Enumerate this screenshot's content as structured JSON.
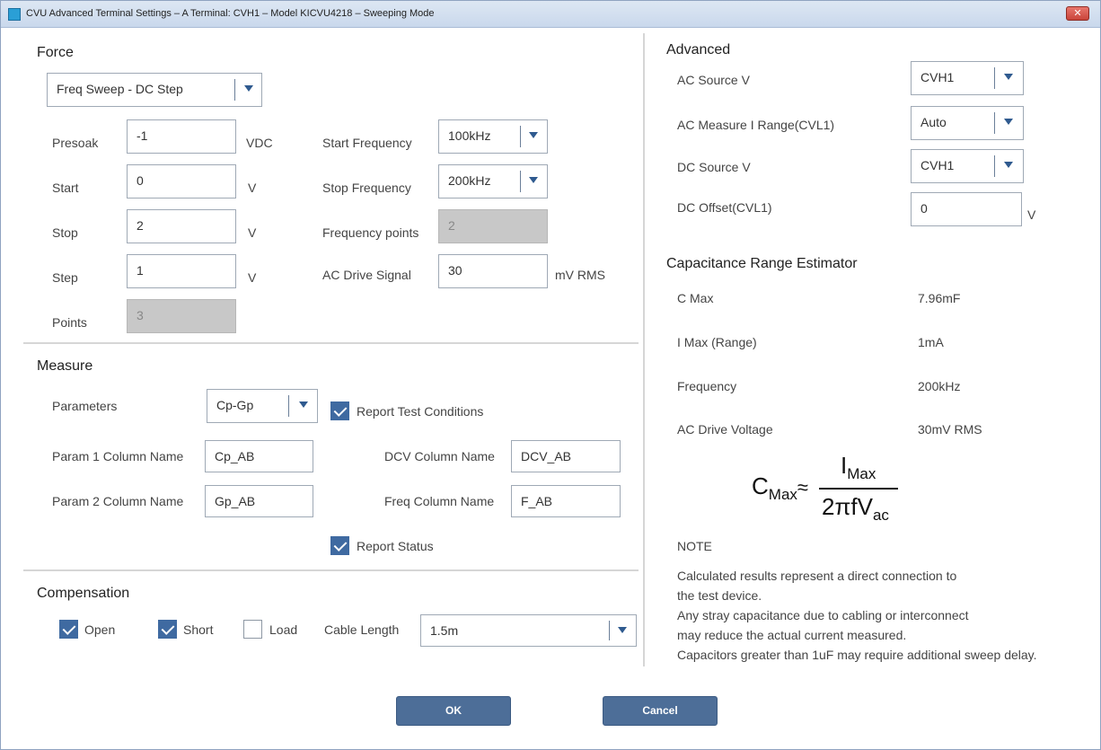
{
  "window": {
    "title": "CVU Advanced Terminal Settings – A Terminal: CVH1 – Model KICVU4218 – Sweeping Mode",
    "close": "✕"
  },
  "force": {
    "title": "Force",
    "mode": "Freq Sweep - DC Step",
    "presoak": {
      "label": "Presoak",
      "value": "-1",
      "unit": "VDC"
    },
    "start": {
      "label": "Start",
      "value": "0",
      "unit": "V"
    },
    "stop": {
      "label": "Stop",
      "value": "2",
      "unit": "V"
    },
    "step": {
      "label": "Step",
      "value": "1",
      "unit": "V"
    },
    "points": {
      "label": "Points",
      "value": "3"
    },
    "start_frequency": {
      "label": "Start Frequency",
      "value": "100kHz"
    },
    "stop_frequency": {
      "label": "Stop Frequency",
      "value": "200kHz"
    },
    "frequency_points": {
      "label": "Frequency points",
      "value": "2"
    },
    "ac_drive_signal": {
      "label": "AC Drive Signal",
      "value": "30",
      "unit": "mV RMS"
    }
  },
  "measure": {
    "title": "Measure",
    "parameters": {
      "label": "Parameters",
      "value": "Cp-Gp"
    },
    "report_test_conditions": {
      "label": "Report Test Conditions",
      "checked": true
    },
    "param1": {
      "label": "Param 1 Column Name",
      "value": "Cp_AB"
    },
    "param2": {
      "label": "Param 2 Column Name",
      "value": "Gp_AB"
    },
    "dcv": {
      "label": "DCV Column Name",
      "value": "DCV_AB"
    },
    "freq": {
      "label": "Freq Column Name",
      "value": "F_AB"
    },
    "report_status": {
      "label": "Report Status",
      "checked": true
    }
  },
  "compensation": {
    "title": "Compensation",
    "open": {
      "label": "Open",
      "checked": true
    },
    "short": {
      "label": "Short",
      "checked": true
    },
    "load": {
      "label": "Load",
      "checked": false
    },
    "cable_length": {
      "label": "Cable Length",
      "value": "1.5m"
    }
  },
  "advanced": {
    "title": "Advanced",
    "ac_source_v": {
      "label": "AC Source V",
      "value": "CVH1"
    },
    "ac_measure_i_range": {
      "label": "AC Measure I Range(CVL1)",
      "value": "Auto"
    },
    "dc_source_v": {
      "label": "DC Source V",
      "value": "CVH1"
    },
    "dc_offset": {
      "label": "DC Offset(CVL1)",
      "value": "0",
      "unit": "V"
    }
  },
  "estimator": {
    "title": "Capacitance Range Estimator",
    "c_max": {
      "label": "C Max",
      "value": "7.96mF"
    },
    "i_max": {
      "label": "I Max (Range)",
      "value": "1mA"
    },
    "frequency": {
      "label": "Frequency",
      "value": "200kHz"
    },
    "ac_drive_voltage": {
      "label": "AC Drive Voltage",
      "value": "30mV RMS"
    },
    "formula": {
      "lhs": "C",
      "lhs_sub": "Max",
      "approx": "≈",
      "num": "I",
      "num_sub": "Max",
      "den": "2πfV",
      "den_sub": "ac"
    },
    "note_title": "NOTE",
    "note_lines": [
      "Calculated results represent a direct connection to",
      "the test device.",
      "Any stray capacitance due to cabling or interconnect",
      "may reduce the actual current measured.",
      "Capacitors greater than 1uF may require additional sweep delay."
    ]
  },
  "buttons": {
    "ok": "OK",
    "cancel": "Cancel"
  }
}
